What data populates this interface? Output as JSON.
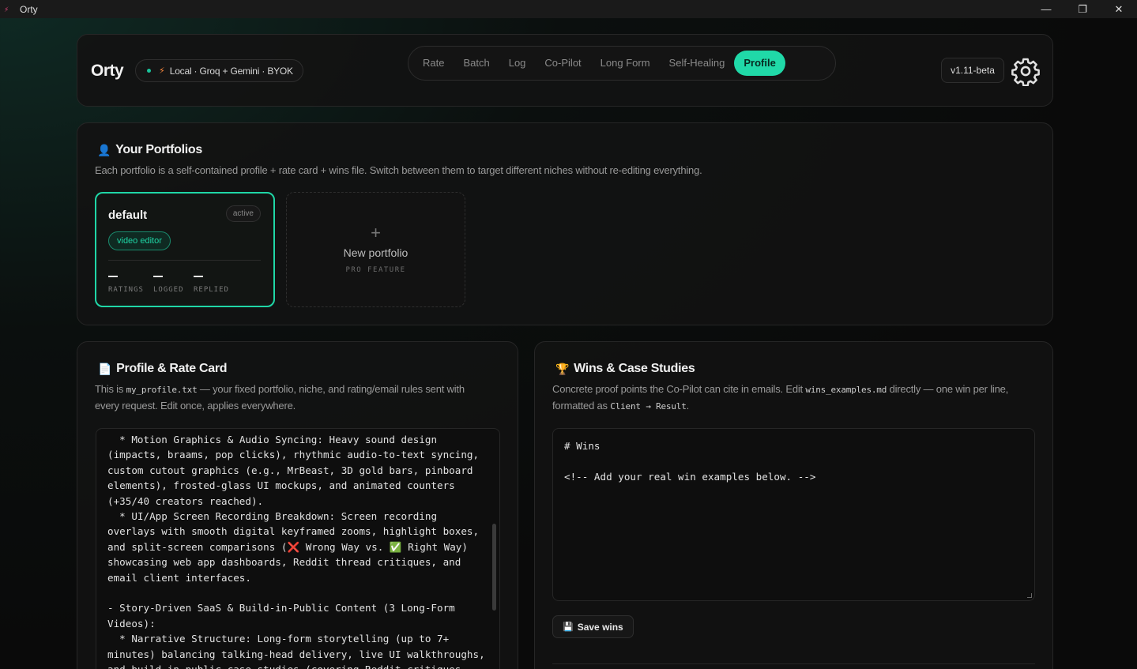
{
  "window": {
    "title": "Orty",
    "controls": {
      "minimize": "—",
      "restore": "❐",
      "close": "✕"
    }
  },
  "header": {
    "brand": "Orty",
    "status_text": "Local · Groq + Gemini · BYOK",
    "status_dot_color": "#19c39a",
    "tabs": [
      {
        "label": "Rate",
        "active": false
      },
      {
        "label": "Batch",
        "active": false
      },
      {
        "label": "Log",
        "active": false
      },
      {
        "label": "Co-Pilot",
        "active": false
      },
      {
        "label": "Long Form",
        "active": false
      },
      {
        "label": "Self-Healing",
        "active": false
      },
      {
        "label": "Profile",
        "active": true
      }
    ],
    "version": "v1.11-beta",
    "accent_color": "#20d9a8"
  },
  "portfolios": {
    "title": "Your Portfolios",
    "description": "Each portfolio is a self-contained profile + rate card + wins file. Switch between them to target different niches without re-editing everything.",
    "items": [
      {
        "name": "default",
        "badge": "active",
        "tag": "video editor",
        "stats": [
          {
            "label": "RATINGS"
          },
          {
            "label": "LOGGED"
          },
          {
            "label": "REPLIED"
          }
        ]
      }
    ],
    "new_portfolio": {
      "icon": "+",
      "label": "New portfolio",
      "sublabel": "PRO FEATURE"
    }
  },
  "profile": {
    "title": "Profile & Rate Card",
    "desc_prefix": "This is ",
    "desc_file": "my_profile.txt",
    "desc_suffix": " — your fixed portfolio, niche, and rating/email rules sent with every request. Edit once, applies everywhere.",
    "content": "  * Motion Graphics & Audio Syncing: Heavy sound design (impacts, braams, pop clicks), rhythmic audio-to-text syncing, custom cutout graphics (e.g., MrBeast, 3D gold bars, pinboard elements), frosted-glass UI mockups, and animated counters (+35/40 creators reached).\n  * UI/App Screen Recording Breakdown: Screen recording overlays with smooth digital keyframed zooms, highlight boxes, and split-screen comparisons (❌ Wrong Way vs. ✅ Right Way) showcasing web app dashboards, Reddit thread critiques, and email client interfaces.\n\n- Story-Driven SaaS & Build-in-Public Content (3 Long-Form Videos):\n  * Narrative Structure: Long-form storytelling (up to 7+ minutes) balancing talking-head delivery, live UI walkthroughs, and build-in-public case studies (covering Reddit critiques,"
  },
  "wins": {
    "title": "Wins & Case Studies",
    "desc_prefix": "Concrete proof points the Co-Pilot can cite in emails. Edit ",
    "desc_file": "wins_examples.md",
    "desc_middle": " directly — one win per line, formatted as ",
    "desc_format": "Client → Result",
    "desc_suffix": ".",
    "content": "# Wins\n\n<!-- Add your real win examples below. -->",
    "save_label": "Save wins"
  }
}
